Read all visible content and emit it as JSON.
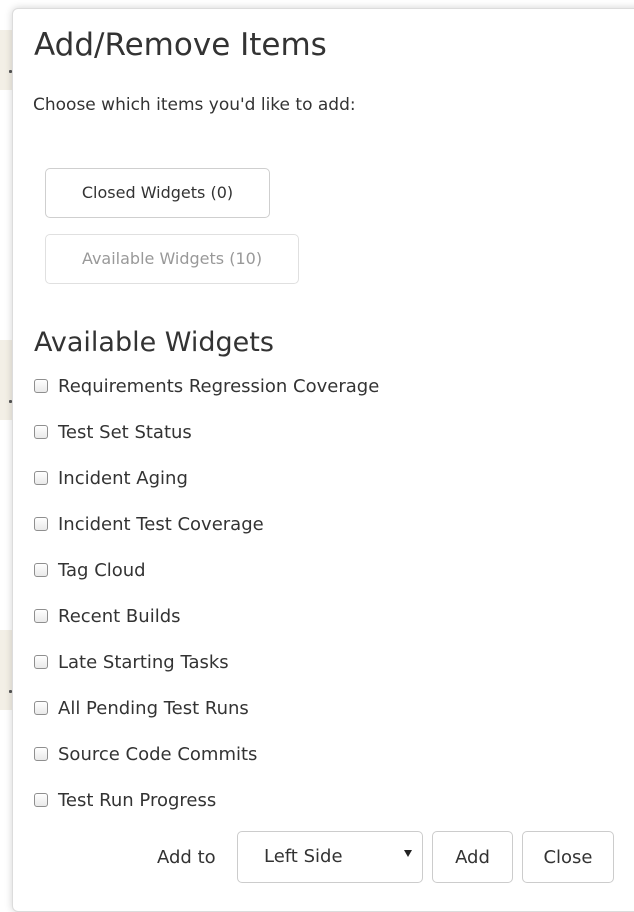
{
  "dialog": {
    "title": "Add/Remove Items",
    "intro": "Choose which items you'd like to add:"
  },
  "tabs": {
    "closed_label": "Closed Widgets (0)",
    "available_label": "Available Widgets (10)"
  },
  "section": {
    "title": "Available Widgets"
  },
  "widgets": [
    {
      "label": "Requirements Regression Coverage",
      "checked": false
    },
    {
      "label": "Test Set Status",
      "checked": false
    },
    {
      "label": "Incident Aging",
      "checked": false
    },
    {
      "label": "Incident Test Coverage",
      "checked": false
    },
    {
      "label": "Tag Cloud",
      "checked": false
    },
    {
      "label": "Recent Builds",
      "checked": false
    },
    {
      "label": "Late Starting Tasks",
      "checked": false
    },
    {
      "label": "All Pending Test Runs",
      "checked": false
    },
    {
      "label": "Source Code Commits",
      "checked": false
    },
    {
      "label": "Test Run Progress",
      "checked": false
    }
  ],
  "footer": {
    "add_to_label": "Add to",
    "position_select": {
      "value": "Left Side",
      "icon": "caret-down-icon"
    },
    "add_button": "Add",
    "close_button": "Close"
  }
}
